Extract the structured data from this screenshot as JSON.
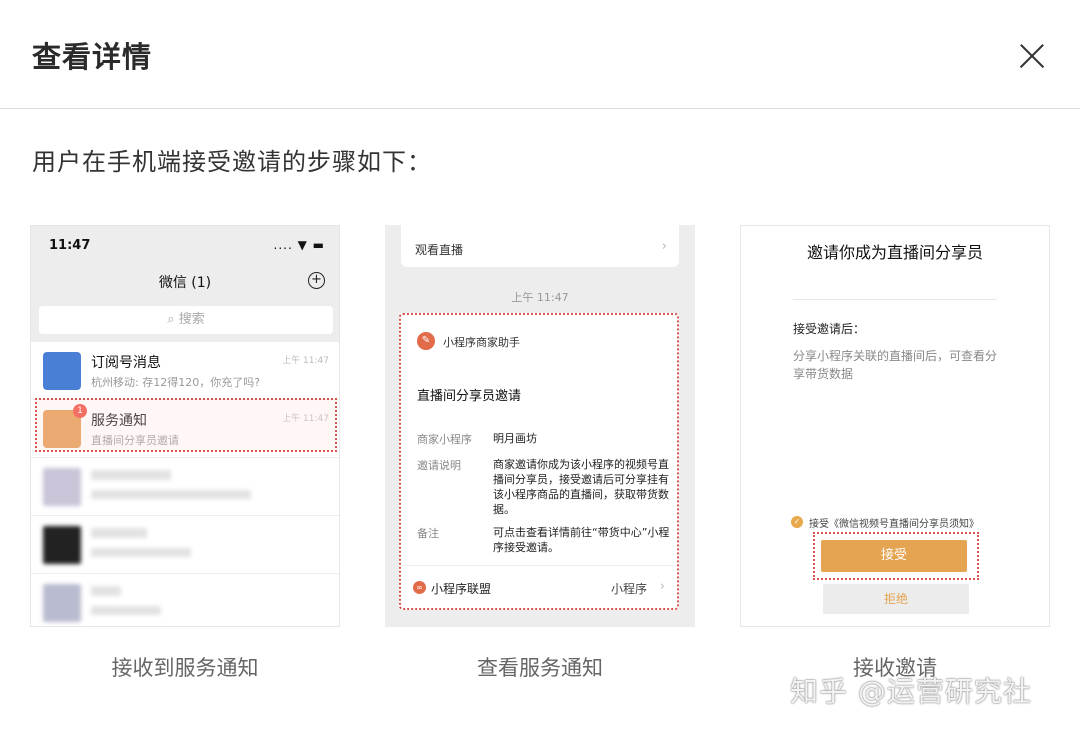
{
  "dialog": {
    "title": "查看详情"
  },
  "intro": "用户在手机端接受邀请的步骤如下：",
  "step1": {
    "caption": "接收到服务通知",
    "status_time": "11:47",
    "status_right": "....  ▼ ▬",
    "nav_title": "微信 (1)",
    "search_placeholder": "搜索",
    "rows": [
      {
        "name": "订阅号消息",
        "msg": "杭州移动: 存12得120，你充了吗?",
        "time": "上午 11:47"
      },
      {
        "name": "服务通知",
        "msg": "直播间分享员邀请",
        "time": "上午 11:47",
        "badge": "1"
      }
    ]
  },
  "step2": {
    "caption": "查看服务通知",
    "top_label": "观看直播",
    "msg_time": "上午 11:47",
    "from": "小程序商家助手",
    "title": "直播间分享员邀请",
    "fields": [
      {
        "key": "商家小程序",
        "value": "明月画坊"
      },
      {
        "key": "邀请说明",
        "value": "商家邀请你成为该小程序的视频号直播间分享员，接受邀请后可分享挂有该小程序商品的直播间，获取带货数据。"
      },
      {
        "key": "备注",
        "value": "可点击查看详情前往“带货中心”小程序接受邀请。"
      }
    ],
    "footer_left": "小程序联盟",
    "footer_right": "小程序"
  },
  "step3": {
    "caption": "接收邀请",
    "title": "邀请你成为直播间分享员",
    "subtitle": "接受邀请后：",
    "description": "分享小程序关联的直播间后，可查看分享带货数据",
    "agree_text": "接受《微信视频号直播间分享员须知》",
    "accept_label": "接受",
    "reject_label": "拒绝"
  },
  "watermark": "知乎 @运营研究社",
  "colors": {
    "accent": "#e5a451",
    "highlight": "#d9534f",
    "badge": "#f24c3d"
  }
}
